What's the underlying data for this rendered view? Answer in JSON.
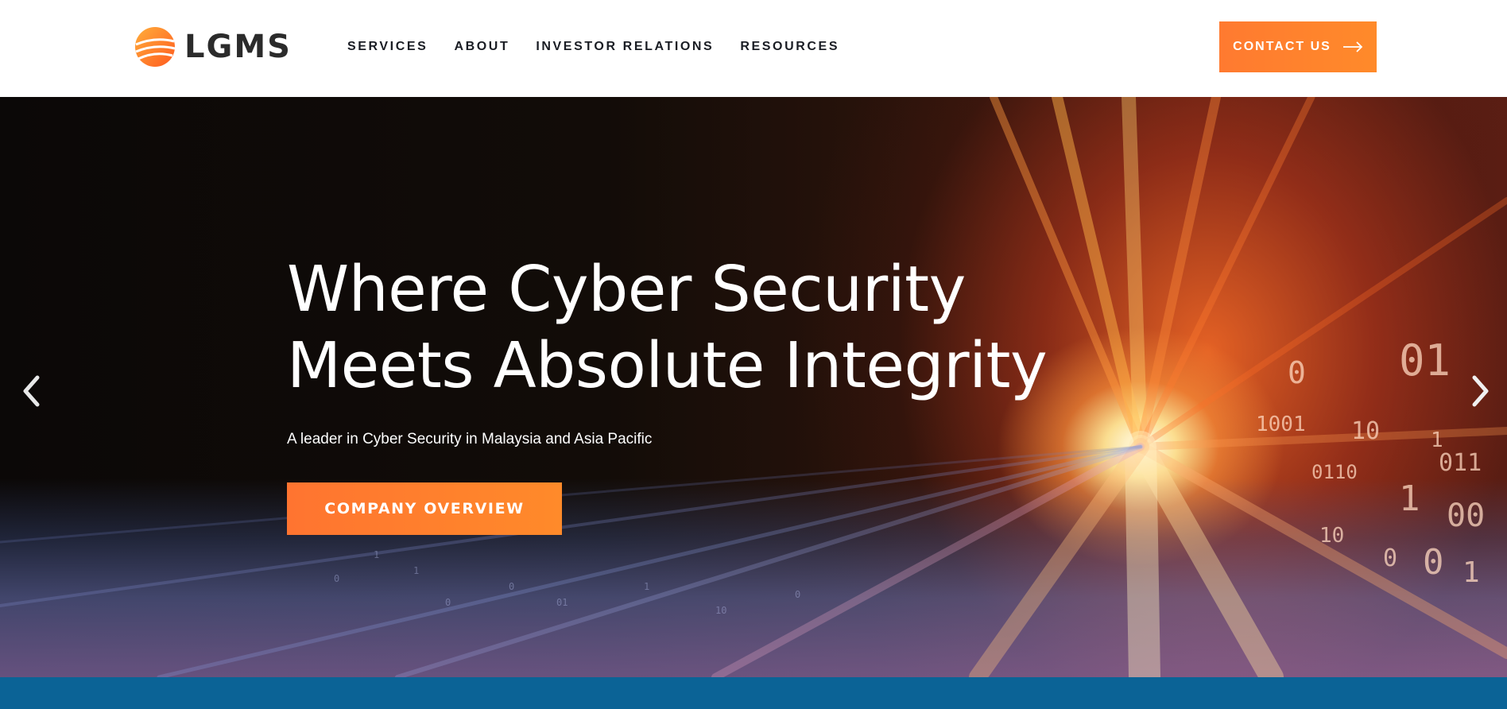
{
  "header": {
    "logo_text": "LGMS",
    "nav": [
      {
        "label": "SERVICES"
      },
      {
        "label": "ABOUT"
      },
      {
        "label": "INVESTOR RELATIONS"
      },
      {
        "label": "RESOURCES"
      }
    ],
    "contact_label": "CONTACT US",
    "contact_icon": "arrow-right-icon"
  },
  "hero": {
    "title_line1": "Where Cyber Security",
    "title_line2": "Meets Absolute Integrity",
    "subtitle": "A leader in Cyber Security in Malaysia and Asia Pacific",
    "cta_label": "COMPANY OVERVIEW",
    "prev_icon": "chevron-left-icon",
    "next_icon": "chevron-right-icon"
  },
  "colors": {
    "accent": "#ff7f2e",
    "band": "#0b6396",
    "nav_text": "#1a1d24"
  }
}
